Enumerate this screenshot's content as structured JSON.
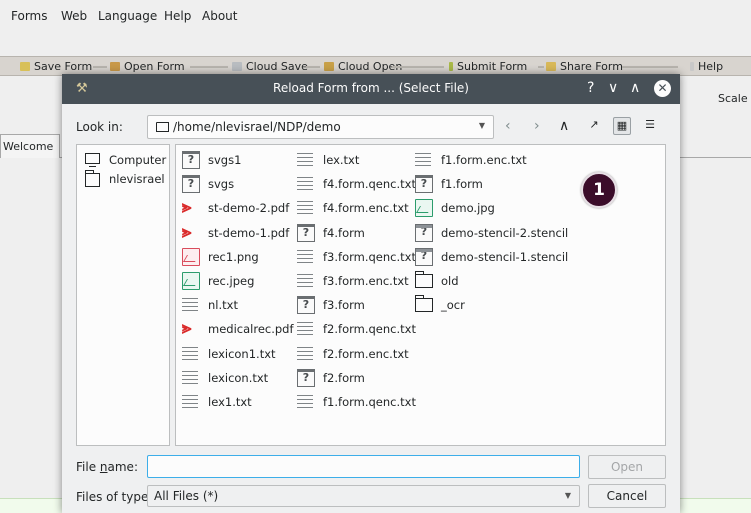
{
  "menubar": {
    "items": [
      "Forms",
      "Web",
      "Language",
      "Help",
      "About"
    ]
  },
  "toolbar": {
    "items": [
      "Save Form",
      "Open Form",
      "Cloud Save",
      "Cloud Open",
      "Submit Form",
      "Share Form",
      "Help"
    ],
    "scale_label": "Scale"
  },
  "welcome_tab": "Welcome",
  "dialog": {
    "title": "Reload Form from ... (Select File)",
    "controls": {
      "help": "?",
      "minimize": "∨",
      "maximize": "∧",
      "close": "✕"
    },
    "look_in_label": "Look in:",
    "path": "/home/nlevisrael/NDP/demo",
    "sidebar": [
      {
        "label": "Computer",
        "icon": "computer-icon"
      },
      {
        "label": "nlevisrael",
        "icon": "folder-icon"
      }
    ],
    "files_col1": [
      {
        "name": "svgs1",
        "type": "unknown"
      },
      {
        "name": "svgs",
        "type": "unknown"
      },
      {
        "name": "st-demo-2.pdf",
        "type": "pdf"
      },
      {
        "name": "st-demo-1.pdf",
        "type": "pdf"
      },
      {
        "name": "rec1.png",
        "type": "image-red"
      },
      {
        "name": "rec.jpeg",
        "type": "image-green"
      },
      {
        "name": "nl.txt",
        "type": "text"
      },
      {
        "name": "medicalrec.pdf",
        "type": "pdf"
      },
      {
        "name": "lexicon1.txt",
        "type": "text"
      },
      {
        "name": "lexicon.txt",
        "type": "text"
      },
      {
        "name": "lex1.txt",
        "type": "text"
      }
    ],
    "files_col2": [
      {
        "name": "lex.txt",
        "type": "text"
      },
      {
        "name": "f4.form.qenc.txt",
        "type": "text"
      },
      {
        "name": "f4.form.enc.txt",
        "type": "text"
      },
      {
        "name": "f4.form",
        "type": "unknown"
      },
      {
        "name": "f3.form.qenc.txt",
        "type": "text"
      },
      {
        "name": "f3.form.enc.txt",
        "type": "text"
      },
      {
        "name": "f3.form",
        "type": "unknown"
      },
      {
        "name": "f2.form.qenc.txt",
        "type": "text"
      },
      {
        "name": "f2.form.enc.txt",
        "type": "text"
      },
      {
        "name": "f2.form",
        "type": "unknown"
      },
      {
        "name": "f1.form.qenc.txt",
        "type": "text"
      }
    ],
    "files_col3": [
      {
        "name": "f1.form.enc.txt",
        "type": "text"
      },
      {
        "name": "f1.form",
        "type": "unknown"
      },
      {
        "name": "demo.jpg",
        "type": "image-green"
      },
      {
        "name": "demo-stencil-2.stencil",
        "type": "stencil"
      },
      {
        "name": "demo-stencil-1.stencil",
        "type": "stencil"
      },
      {
        "name": "old",
        "type": "folder"
      },
      {
        "name": "_ocr",
        "type": "folder"
      }
    ],
    "badge": "1",
    "file_name_label_pre": "File ",
    "file_name_label_u": "n",
    "file_name_label_post": "ame:",
    "file_name_value": "",
    "open_button": "Open",
    "files_of_type_label": "Files of type:",
    "files_of_type_value": "All Files (*)",
    "cancel_button": "Cancel"
  },
  "colors": {
    "titlebar": "#475057",
    "focus": "#3daee9",
    "pdf": "#da2a2a",
    "badge": "#3b0d2a"
  }
}
